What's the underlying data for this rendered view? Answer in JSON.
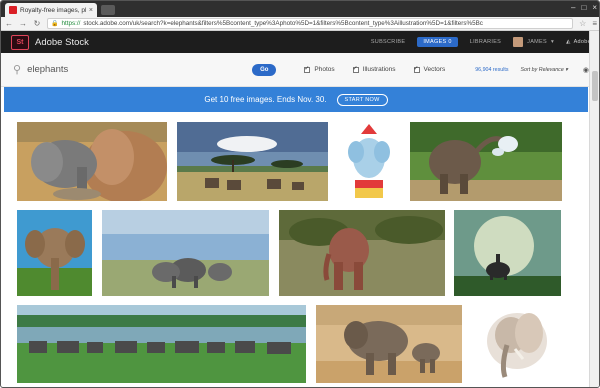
{
  "browser": {
    "tab_title": "Royalty-free images, phot",
    "tab_close": "×",
    "url_scheme": "https://",
    "url_rest": "stock.adobe.com/uk/search?k=elephants&filters%5Bcontent_type%3Aphoto%5D=1&filters%5Bcontent_type%3Aillustration%5D=1&filters%5Bc",
    "window_controls": [
      "–",
      "□",
      "×"
    ]
  },
  "header": {
    "logo_text": "St",
    "brand": "Adobe Stock",
    "subscribe": "SUBSCRIBE",
    "images_label": "IMAGES 0",
    "libraries": "LIBRARIES",
    "user": "JAMES",
    "adobe": "Adobe"
  },
  "search": {
    "query": "elephants",
    "go_label": "Go",
    "filters": [
      "Photos",
      "Illustrations",
      "Vectors"
    ],
    "results": "96,904 results",
    "sort": "Sort by Relevance"
  },
  "banner": {
    "text": "Get 10 free images. Ends Nov. 30.",
    "cta": "START NOW"
  },
  "colors": {
    "accent": "#2c6ac8",
    "banner": "#3481d8",
    "header_bg": "#1d1d1d"
  },
  "thumbnails": [
    {
      "name": "thumb-elephant-family-closeup"
    },
    {
      "name": "thumb-savanna-herd-acacia"
    },
    {
      "name": "thumb-circus-elephant-illustration"
    },
    {
      "name": "thumb-elephant-spraying-water"
    },
    {
      "name": "thumb-elephant-blue-sky"
    },
    {
      "name": "thumb-elephants-grassland"
    },
    {
      "name": "thumb-elephant-bush"
    },
    {
      "name": "thumb-elephant-rider-surreal"
    },
    {
      "name": "thumb-herd-by-lake"
    },
    {
      "name": "thumb-elephant-calf-sand"
    },
    {
      "name": "thumb-elephant-watercolor"
    }
  ]
}
